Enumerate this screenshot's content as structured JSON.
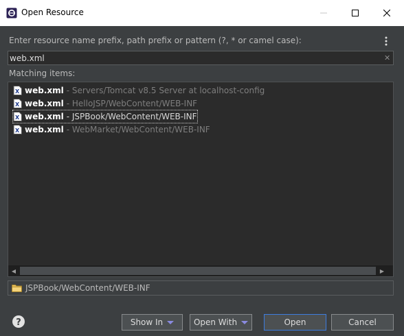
{
  "window": {
    "title": "Open Resource"
  },
  "prompt": "Enter resource name prefix, path prefix or pattern (?, * or camel case):",
  "search": {
    "value": "web.xml"
  },
  "matching_label": "Matching items:",
  "items": [
    {
      "name": "web.xml",
      "path": "- Servers/Tomcat v8.5 Server at localhost-config",
      "selected": false
    },
    {
      "name": "web.xml",
      "path": "- HelloJSP/WebContent/WEB-INF",
      "selected": false
    },
    {
      "name": "web.xml",
      "path": "- JSPBook/WebContent/WEB-INF",
      "selected": true
    },
    {
      "name": "web.xml",
      "path": "- WebMarket/WebContent/WEB-INF",
      "selected": false
    }
  ],
  "status_path": "JSPBook/WebContent/WEB-INF",
  "buttons": {
    "show_in": "Show In",
    "open_with": "Open With",
    "open": "Open",
    "cancel": "Cancel"
  },
  "colors": {
    "background": "#3c3f41",
    "list_background": "#2b2b2b",
    "default_button_border": "#3d7de0"
  }
}
